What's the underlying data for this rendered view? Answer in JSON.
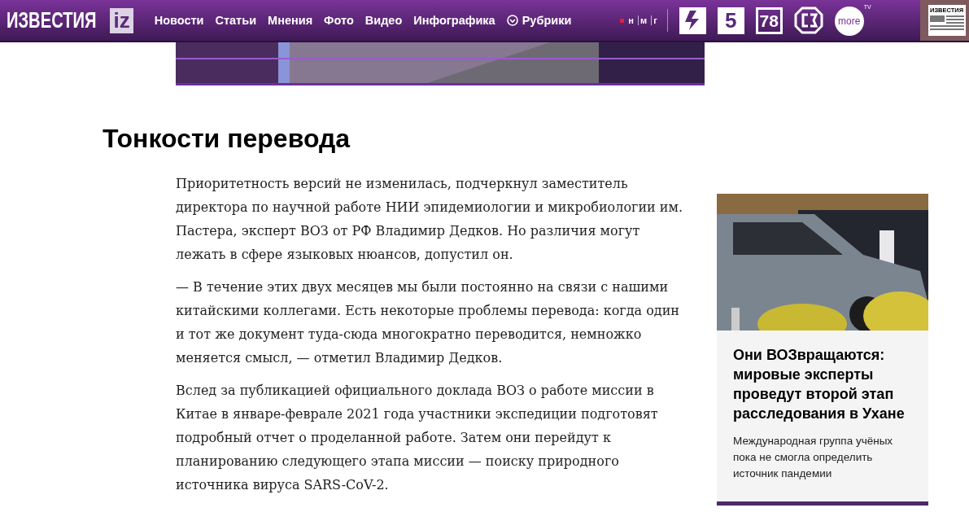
{
  "header": {
    "logo": {
      "text": "ИЗВЕСТИЯ",
      "badge": "iz"
    },
    "nav": [
      {
        "label": "Новости",
        "kind": "link"
      },
      {
        "label": "Статьи",
        "kind": "link"
      },
      {
        "label": "Мнения",
        "kind": "link"
      },
      {
        "label": "Фото",
        "kind": "link"
      },
      {
        "label": "Видео",
        "kind": "link"
      },
      {
        "label": "Инфографика",
        "kind": "link"
      },
      {
        "label": "Рубрики",
        "kind": "dropdown"
      }
    ],
    "group_links": [
      "н",
      "м",
      "г"
    ],
    "channels": [
      {
        "kind": "ren"
      },
      {
        "kind": "text",
        "label": "5"
      },
      {
        "kind": "boxed",
        "label": "78"
      },
      {
        "kind": "sz"
      },
      {
        "kind": "more",
        "label": "more",
        "sup": "TV"
      },
      {
        "kind": "paper",
        "label": "ИЗВЕСТИЯ"
      }
    ]
  },
  "article": {
    "heading": "Тонкости перевода",
    "paragraphs": [
      "Приоритетность версий не изменилась, подчеркнул заместитель директора по научной работе НИИ эпидемиологии и микробиологии им. Пастера, эксперт ВОЗ от РФ Владимир Дедков. Но различия могут лежать в сфере языковых нюансов, допустил он.",
      "— В течение этих двух месяцев мы были постоянно на связи с нашими китайскими коллегами. Есть некоторые проблемы перевода: когда один и тот же документ туда-сюда многократно переводится, немножко меняется смысл, — отметил Владимир Дедков.",
      "Вслед за публикацией официального доклада ВОЗ о работе миссии в Китае в январе-феврале 2021 года участники экспедиции подготовят подробный отчет о проделанной работе. Затем они перейдут к планированию следующего этапа миссии — поиску природного источника вируса SARS-CoV-2."
    ]
  },
  "related": {
    "title": "Они ВОЗвращаются: мировые эксперты проведут второй этап расследования в Ухане",
    "lead": "Международная группа учёных пока не смогла определить источник пандемии"
  }
}
